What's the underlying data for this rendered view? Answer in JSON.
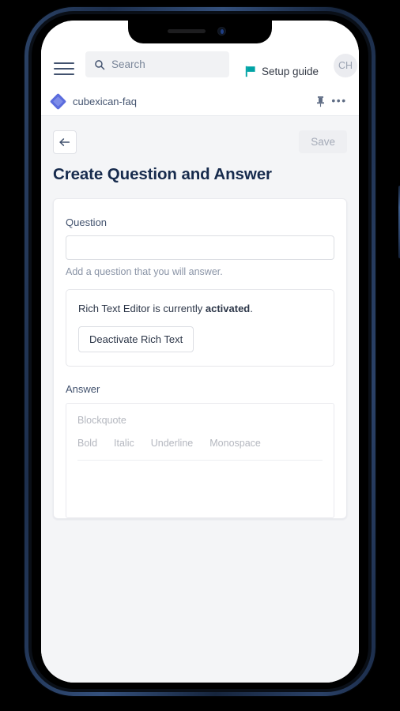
{
  "device": {
    "frame": "iphone-mockup",
    "notch_icons": [
      "speaker-slot",
      "front-camera"
    ]
  },
  "topbar": {
    "menu_icon": "hamburger-icon",
    "search": {
      "icon": "search-icon",
      "placeholder": "Search",
      "value": ""
    },
    "setup_guide": {
      "icon": "flag-icon",
      "label": "Setup guide",
      "icon_color": "#00a3a5"
    },
    "avatar": {
      "initials": "CH"
    }
  },
  "breadcrumb": {
    "icon": "space-diamond-icon",
    "icon_color": "#5b6cdd",
    "label": "cubexican-faq",
    "pin_icon": "pin-icon",
    "more_icon": "more-horizontal-icon"
  },
  "page": {
    "back_icon": "arrow-left-icon",
    "save_label": "Save",
    "save_disabled": true,
    "title": "Create Question and Answer"
  },
  "form": {
    "question": {
      "label": "Question",
      "value": "",
      "placeholder": "",
      "help": "Add a question that you will answer."
    },
    "rich_text": {
      "status_prefix": "Rich Text Editor is currently ",
      "status_state": "activated",
      "status_suffix": ".",
      "toggle_label": "Deactivate Rich Text"
    },
    "answer": {
      "label": "Answer",
      "toolbar": {
        "block_style": "Blockquote",
        "marks": [
          "Bold",
          "Italic",
          "Underline",
          "Monospace"
        ]
      },
      "body": ""
    }
  },
  "colors": {
    "page_background": "#f4f5f7",
    "card_background": "#ffffff",
    "title_text": "#172b4d",
    "muted_text": "#8a94a6",
    "accent_teal": "#00a3a5",
    "accent_blue": "#5b6cdd"
  }
}
